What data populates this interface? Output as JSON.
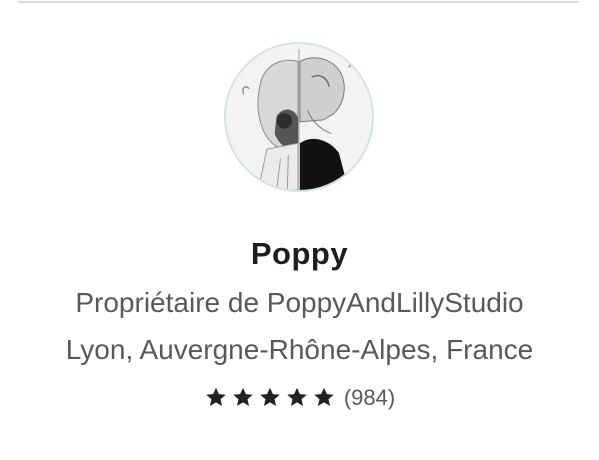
{
  "profile": {
    "name": "Poppy",
    "role": "Propriétaire de PoppyAndLillyStudio",
    "location": "Lyon, Auvergne-Rhône-Alpes, France",
    "rating": {
      "stars": 5,
      "max_stars": 5,
      "count": "(984)"
    }
  },
  "colors": {
    "star": "#222222",
    "secondary_text": "#595959",
    "avatar_border": "#cfe6df"
  },
  "icons": {
    "avatar": "avatar-illustration",
    "star": "star-icon"
  }
}
